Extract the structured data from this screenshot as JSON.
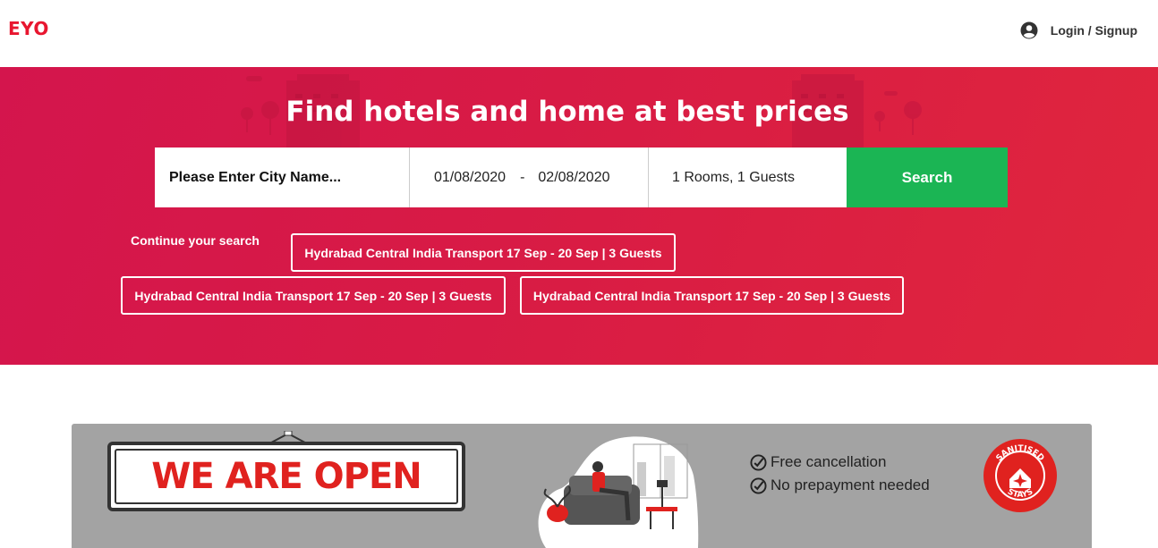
{
  "header": {
    "logo": "EYO",
    "login_label": "Login / Signup"
  },
  "hero": {
    "title": "Find hotels and home at best prices",
    "city_placeholder": "Please Enter City Name...",
    "checkin": "01/08/2020",
    "date_separator": "-",
    "checkout": "02/08/2020",
    "guests": "1 Rooms, 1 Guests",
    "search_label": "Search",
    "continue_label": "Continue your search",
    "recent_searches": [
      "Hydrabad Central India Transport 17 Sep - 20 Sep | 3 Guests",
      "Hydrabad Central India Transport 17 Sep - 20 Sep | 3 Guests",
      "Hydrabad Central India Transport 17 Sep - 20 Sep | 3 Guests"
    ]
  },
  "banner": {
    "sign_text": "WE ARE OPEN",
    "features": [
      "Free cancellation",
      "No prepayment needed"
    ],
    "badge_text": "SANITISED STAYS"
  },
  "colors": {
    "brand": "#e8162f",
    "hero_bg": "#d81b45",
    "search_button": "#1bb554",
    "banner_bg": "#a3a3a3"
  }
}
